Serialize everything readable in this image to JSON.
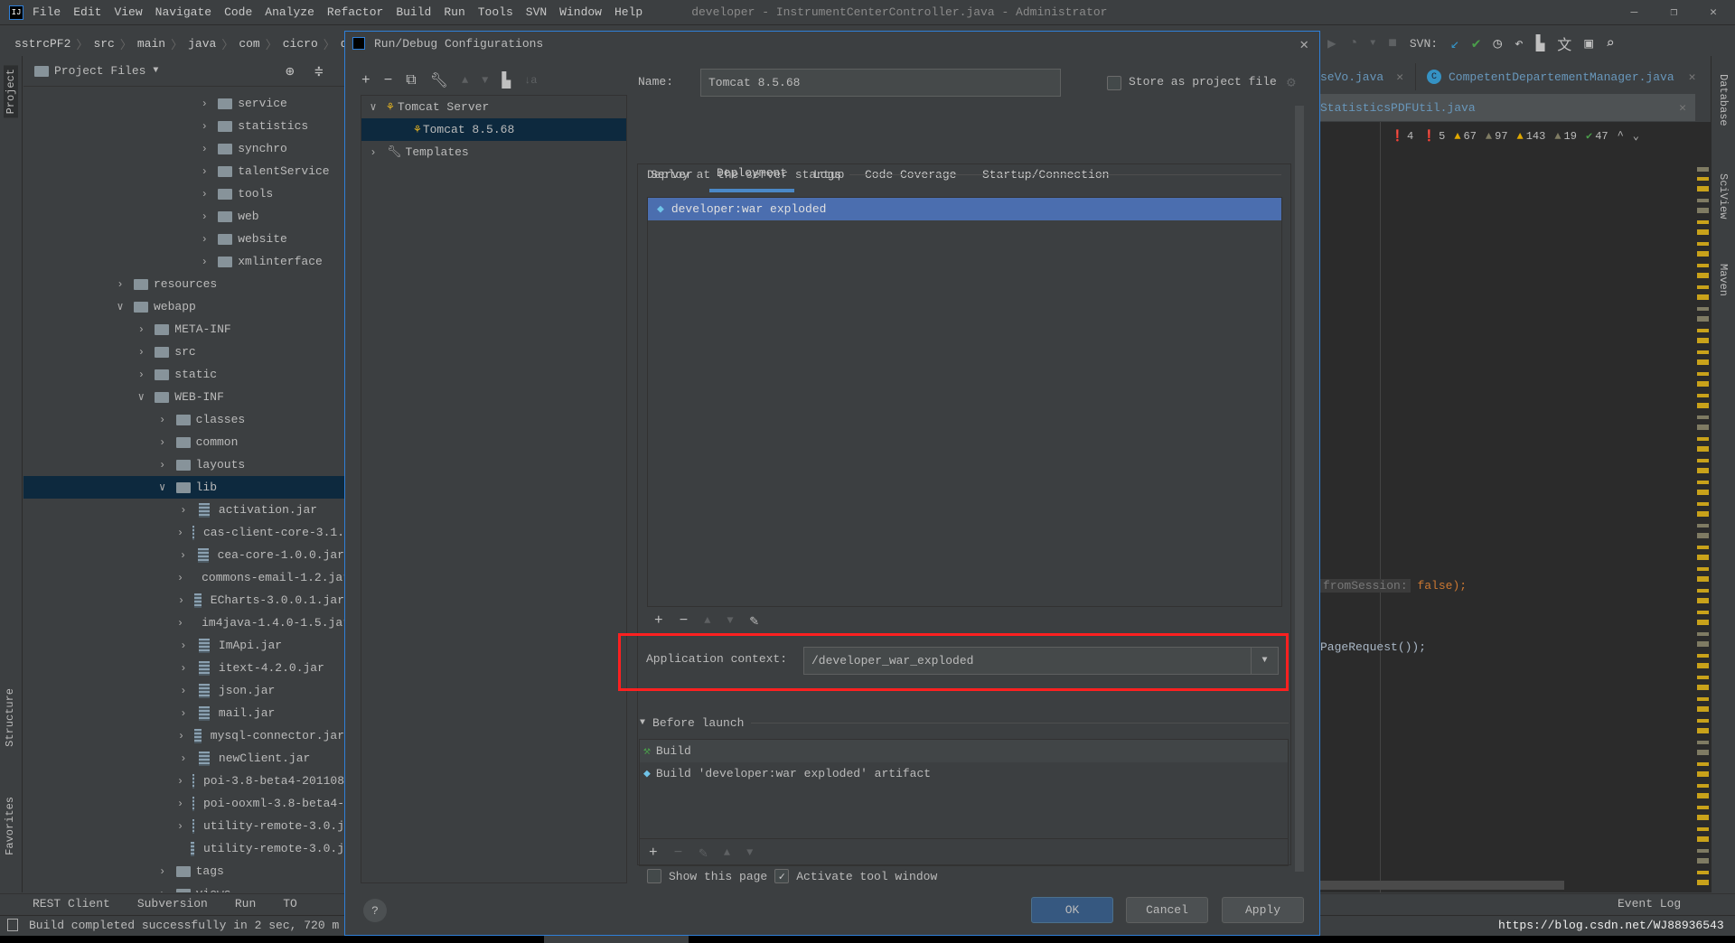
{
  "menubar": {
    "items": [
      "File",
      "Edit",
      "View",
      "Navigate",
      "Code",
      "Analyze",
      "Refactor",
      "Build",
      "Run",
      "Tools",
      "SVN",
      "Window",
      "Help"
    ],
    "window_title": "developer - InstrumentCenterController.java - Administrator"
  },
  "breadcrumb": [
    "sstrcPF2",
    "src",
    "main",
    "java",
    "com",
    "cicro",
    "dev"
  ],
  "left_stripe": {
    "project": "Project",
    "structure": "Structure",
    "favorites": "Favorites"
  },
  "project_panel": {
    "title": "Project Files",
    "items": [
      {
        "l": 4,
        "t": "service",
        "k": "folder",
        "e": false
      },
      {
        "l": 4,
        "t": "statistics",
        "k": "folder",
        "e": false
      },
      {
        "l": 4,
        "t": "synchro",
        "k": "folder",
        "e": false
      },
      {
        "l": 4,
        "t": "talentService",
        "k": "folder",
        "e": false
      },
      {
        "l": 4,
        "t": "tools",
        "k": "folder",
        "e": false
      },
      {
        "l": 4,
        "t": "web",
        "k": "folder",
        "e": false
      },
      {
        "l": 4,
        "t": "website",
        "k": "folder",
        "e": false
      },
      {
        "l": 4,
        "t": "xmlinterface",
        "k": "folder",
        "e": false
      },
      {
        "l": 0,
        "t": "resources",
        "k": "folder",
        "e": false
      },
      {
        "l": 0,
        "t": "webapp",
        "k": "folder",
        "e": true
      },
      {
        "l": 1,
        "t": "META-INF",
        "k": "folder",
        "e": false
      },
      {
        "l": 1,
        "t": "src",
        "k": "folder",
        "e": false
      },
      {
        "l": 1,
        "t": "static",
        "k": "folder",
        "e": false
      },
      {
        "l": 1,
        "t": "WEB-INF",
        "k": "folder",
        "e": true
      },
      {
        "l": 2,
        "t": "classes",
        "k": "folder",
        "e": false
      },
      {
        "l": 2,
        "t": "common",
        "k": "folder",
        "e": false
      },
      {
        "l": 2,
        "t": "layouts",
        "k": "folder",
        "e": false
      },
      {
        "l": 2,
        "t": "lib",
        "k": "folder",
        "e": true,
        "sel": true
      },
      {
        "l": 3,
        "t": "activation.jar",
        "k": "jar",
        "e": false
      },
      {
        "l": 3,
        "t": "cas-client-core-3.1.",
        "k": "jar",
        "e": false
      },
      {
        "l": 3,
        "t": "cea-core-1.0.0.jar",
        "k": "jar",
        "e": false
      },
      {
        "l": 3,
        "t": "commons-email-1.2.jar",
        "k": "jar",
        "e": false
      },
      {
        "l": 3,
        "t": "ECharts-3.0.0.1.jar",
        "k": "jar",
        "e": false
      },
      {
        "l": 3,
        "t": "im4java-1.4.0-1.5.jar",
        "k": "jar",
        "e": false
      },
      {
        "l": 3,
        "t": "ImApi.jar",
        "k": "jar",
        "e": false
      },
      {
        "l": 3,
        "t": "itext-4.2.0.jar",
        "k": "jar",
        "e": false
      },
      {
        "l": 3,
        "t": "json.jar",
        "k": "jar",
        "e": false
      },
      {
        "l": 3,
        "t": "mail.jar",
        "k": "jar",
        "e": false
      },
      {
        "l": 3,
        "t": "mysql-connector.jar",
        "k": "jar",
        "e": false
      },
      {
        "l": 3,
        "t": "newClient.jar",
        "k": "jar",
        "e": false
      },
      {
        "l": 3,
        "t": "poi-3.8-beta4-201108",
        "k": "jar",
        "e": false
      },
      {
        "l": 3,
        "t": "poi-ooxml-3.8-beta4-",
        "k": "jar",
        "e": false
      },
      {
        "l": 3,
        "t": "utility-remote-3.0.j",
        "k": "jar",
        "e": false
      },
      {
        "l": 3,
        "t": "utility-remote-3.0.j",
        "k": "jar",
        "e": null
      },
      {
        "l": 2,
        "t": "tags",
        "k": "folder",
        "e": false
      },
      {
        "l": 2,
        "t": "views",
        "k": "folder",
        "e": false
      }
    ]
  },
  "dialog": {
    "title": "Run/Debug Configurations",
    "tree": {
      "group": "Tomcat Server",
      "config": "Tomcat 8.5.68",
      "templates": "Templates"
    },
    "name_label": "Name:",
    "name_value": "Tomcat 8.5.68",
    "store_label": "Store as project file",
    "store_checked": false,
    "tabs": [
      "Server",
      "Deployment",
      "Logs",
      "Code Coverage",
      "Startup/Connection"
    ],
    "active_tab": "Deployment",
    "deploy_label": "Deploy at the server startup",
    "artifacts": [
      "developer:war exploded"
    ],
    "app_context_label": "Application context:",
    "app_context_value": "/developer_war_exploded",
    "before_launch_label": "Before launch",
    "before_launch_items": [
      "Build",
      "Build 'developer:war exploded' artifact"
    ],
    "show_page_label": "Show this page",
    "show_page_checked": false,
    "activate_label": "Activate tool window",
    "activate_checked": true,
    "ok": "OK",
    "cancel": "Cancel",
    "apply": "Apply",
    "help": "?"
  },
  "toolbar": {
    "svn_label": "SVN:"
  },
  "editor": {
    "tabs": [
      "seVo.java",
      "CompetentDepartementManager.java",
      "StatisticsPDFUtil.java"
    ],
    "inspections": [
      {
        "icon": "error",
        "count": "4",
        "color": "#c93b3b"
      },
      {
        "icon": "error",
        "count": "5",
        "color": "#c93b3b"
      },
      {
        "icon": "warning",
        "count": "67",
        "color": "#e0a800"
      },
      {
        "icon": "weak-warning",
        "count": "97",
        "color": "#7f7b63"
      },
      {
        "icon": "warning",
        "count": "143",
        "color": "#e0a800"
      },
      {
        "icon": "weak-warning",
        "count": "19",
        "color": "#7f7b63"
      },
      {
        "icon": "typo",
        "count": "47",
        "color": "#4a9c4a"
      }
    ],
    "code1_hint": "fromSession:",
    "code1_rest": "false",
    "code1_end": ");",
    "code2": "PageRequest());"
  },
  "right_stripe": {
    "database": "Database",
    "sciview": "SciView",
    "maven": "Maven"
  },
  "bottom_tools": [
    "REST Client",
    "Subversion",
    "Run",
    "TO"
  ],
  "event_log": "Event Log",
  "status": {
    "message": "Build completed successfully in 2 sec, 720 m",
    "watermark": "https://blog.csdn.net/WJ88936543"
  },
  "colors": {
    "accent": "#2f7fd8",
    "selection": "#4b6eaf",
    "highlight_box": "#ff2020"
  }
}
